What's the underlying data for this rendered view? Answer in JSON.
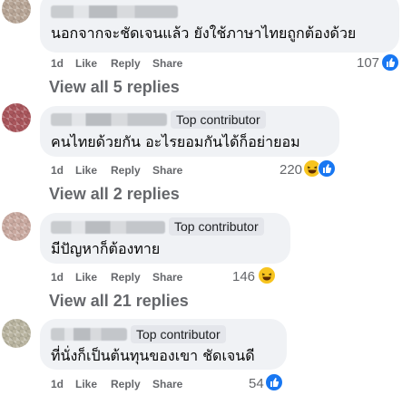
{
  "comments": [
    {
      "name_redacted": true,
      "badge": "",
      "text": "นอกจากจะชัดเจนแล้ว ยังใช้ภาษาไทยถูกต้องด้วย",
      "time": "1d",
      "like_label": "Like",
      "reply_label": "Reply",
      "share_label": "Share",
      "reaction_count": "107",
      "reactions": [
        "like-icon"
      ],
      "view_replies": "View all 5 replies"
    },
    {
      "name_redacted": true,
      "badge": "Top contributor",
      "text": "คนไทยด้วยกัน อะไรยอมกันได้ก็อย่ายอม",
      "time": "1d",
      "like_label": "Like",
      "reply_label": "Reply",
      "share_label": "Share",
      "reaction_count": "220",
      "reactions": [
        "haha-icon",
        "like-icon"
      ],
      "view_replies": "View all 2 replies"
    },
    {
      "name_redacted": true,
      "badge": "Top contributor",
      "text": "มีปัญหาก็ต้องทาย",
      "time": "1d",
      "like_label": "Like",
      "reply_label": "Reply",
      "share_label": "Share",
      "reaction_count": "146",
      "reactions": [
        "haha-icon"
      ],
      "view_replies": "View all 21 replies"
    },
    {
      "name_redacted": true,
      "badge": "Top contributor",
      "text": "ที่นั่งก็เป็นต้นทุนของเขา ชัดเจนดี",
      "time": "1d",
      "like_label": "Like",
      "reply_label": "Reply",
      "share_label": "Share",
      "reaction_count": "54",
      "reactions": [
        "like-icon"
      ],
      "view_replies": ""
    }
  ],
  "colors": {
    "bubble": "#f0f2f5",
    "secondary_text": "#65676b",
    "like_blue": "#1877f2",
    "haha_yellow": "#f7c41f"
  }
}
